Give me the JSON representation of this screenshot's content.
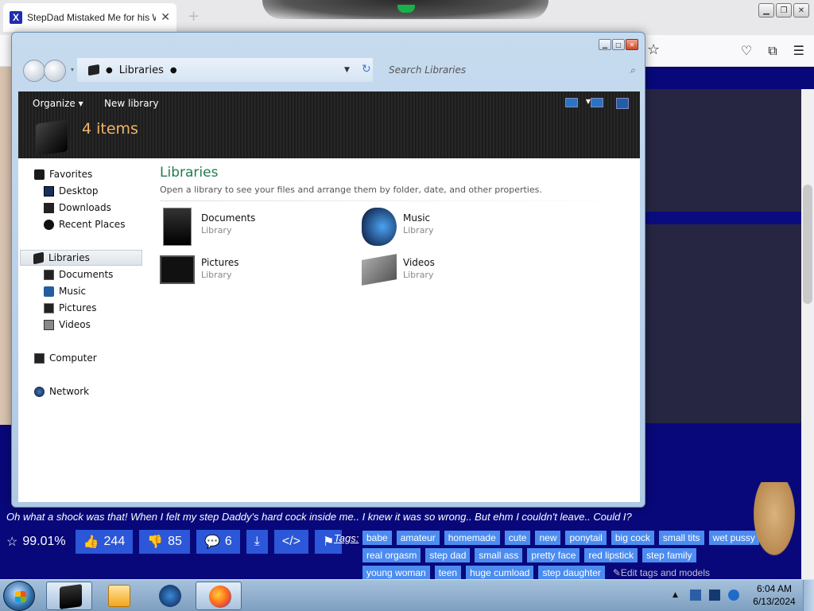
{
  "browser": {
    "tab_title": "StepDad Mistaked Me for his W",
    "tab_favicon": "X",
    "new_tab": "+"
  },
  "explorer": {
    "address": {
      "location": "Libraries",
      "search_placeholder": "Search Libraries"
    },
    "command_bar": {
      "organize": "Organize ▾",
      "new_library": "New library",
      "item_count": "4 items"
    },
    "nav": {
      "favorites": "Favorites",
      "desktop": "Desktop",
      "downloads": "Downloads",
      "recent_places": "Recent Places",
      "libraries": "Libraries",
      "documents": "Documents",
      "music": "Music",
      "pictures": "Pictures",
      "videos": "Videos",
      "computer": "Computer",
      "network": "Network"
    },
    "main": {
      "title": "Libraries",
      "subtitle": "Open a library to see your files and arrange them by folder, date, and other properties.",
      "items": [
        {
          "name": "Documents",
          "type": "Library"
        },
        {
          "name": "Music",
          "type": "Library"
        },
        {
          "name": "Pictures",
          "type": "Library"
        },
        {
          "name": "Videos",
          "type": "Library"
        }
      ]
    }
  },
  "site": {
    "caption": "Oh what a shock was that! When I felt my step Daddy's hard cock inside me.. I knew it was so wrong.. But ehm I couldn't leave.. Could I?",
    "rating": "99.01%",
    "likes": "244",
    "dislikes": "85",
    "comments": "6",
    "tags_label": "Tags:",
    "tags": [
      "babe",
      "amateur",
      "homemade",
      "cute",
      "new",
      "ponytail",
      "big cock",
      "small tits",
      "wet pussy",
      "real orgasm",
      "step dad",
      "small ass",
      "pretty face",
      "red lipstick",
      "step family",
      "young woman",
      "teen",
      "huge cumload",
      "step daughter"
    ],
    "edit_tags": "✎Edit tags and models"
  },
  "taskbar": {
    "time": "6:04 AM",
    "date": "6/13/2024"
  }
}
